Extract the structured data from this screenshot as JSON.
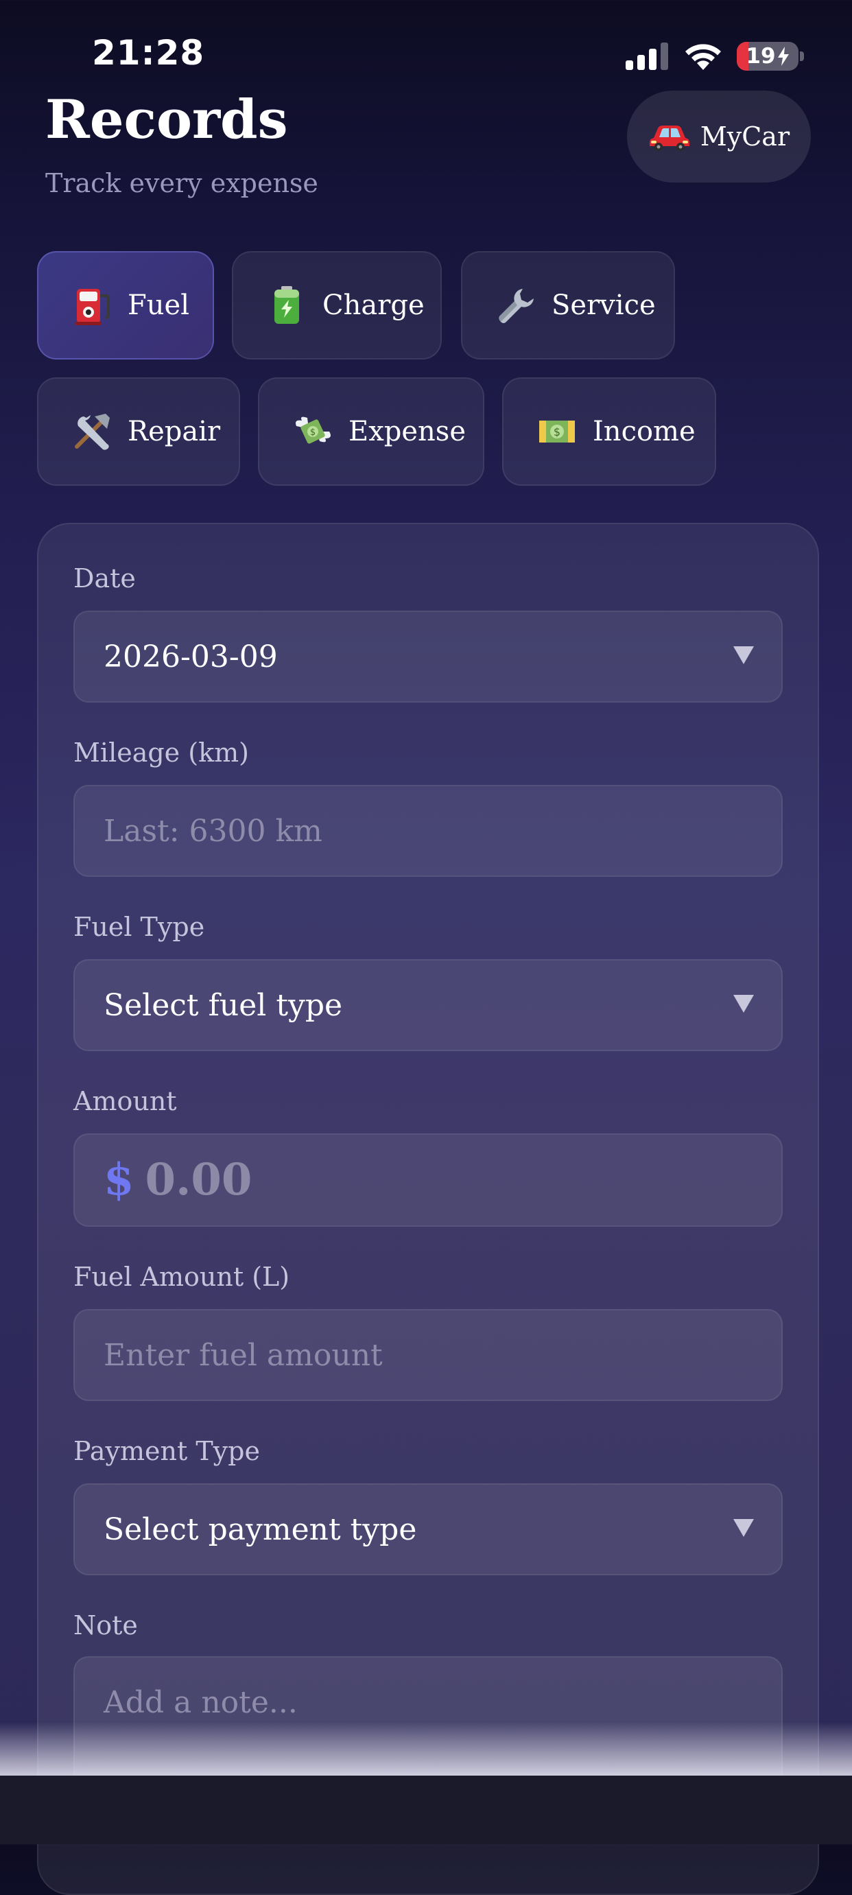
{
  "status_bar": {
    "time": "21:28",
    "battery_level": "19",
    "battery_charging": true
  },
  "header": {
    "title": "Records",
    "subtitle": "Track every expense",
    "vehicle_button": {
      "icon": "red-car-icon",
      "label": "MyCar"
    }
  },
  "categories": [
    {
      "label": "Fuel",
      "icon": "fuel-pump-icon",
      "active": true
    },
    {
      "label": "Charge",
      "icon": "battery-icon",
      "active": false
    },
    {
      "label": "Service",
      "icon": "wrench-icon",
      "active": false
    },
    {
      "label": "Repair",
      "icon": "hammer-wrench-icon",
      "active": false
    },
    {
      "label": "Expense",
      "icon": "money-wings-icon",
      "active": false
    },
    {
      "label": "Income",
      "icon": "banknote-icon",
      "active": false
    }
  ],
  "form": {
    "date": {
      "label": "Date",
      "value": "2026-03-09"
    },
    "mileage": {
      "label": "Mileage (km)",
      "placeholder": "Last: 6300 km"
    },
    "fuel_type": {
      "label": "Fuel Type",
      "value": "Select fuel type"
    },
    "amount": {
      "label": "Amount",
      "currency": "$",
      "placeholder": "0.00"
    },
    "fuel_amount": {
      "label": "Fuel Amount (L)",
      "placeholder": "Enter fuel amount"
    },
    "payment_type": {
      "label": "Payment Type",
      "value": "Select payment type"
    },
    "note": {
      "label": "Note",
      "placeholder": "Add a note..."
    }
  },
  "colors": {
    "accent": "#6f78f0",
    "active_chip": "#3b3984",
    "battery_low": "#e5343f"
  }
}
